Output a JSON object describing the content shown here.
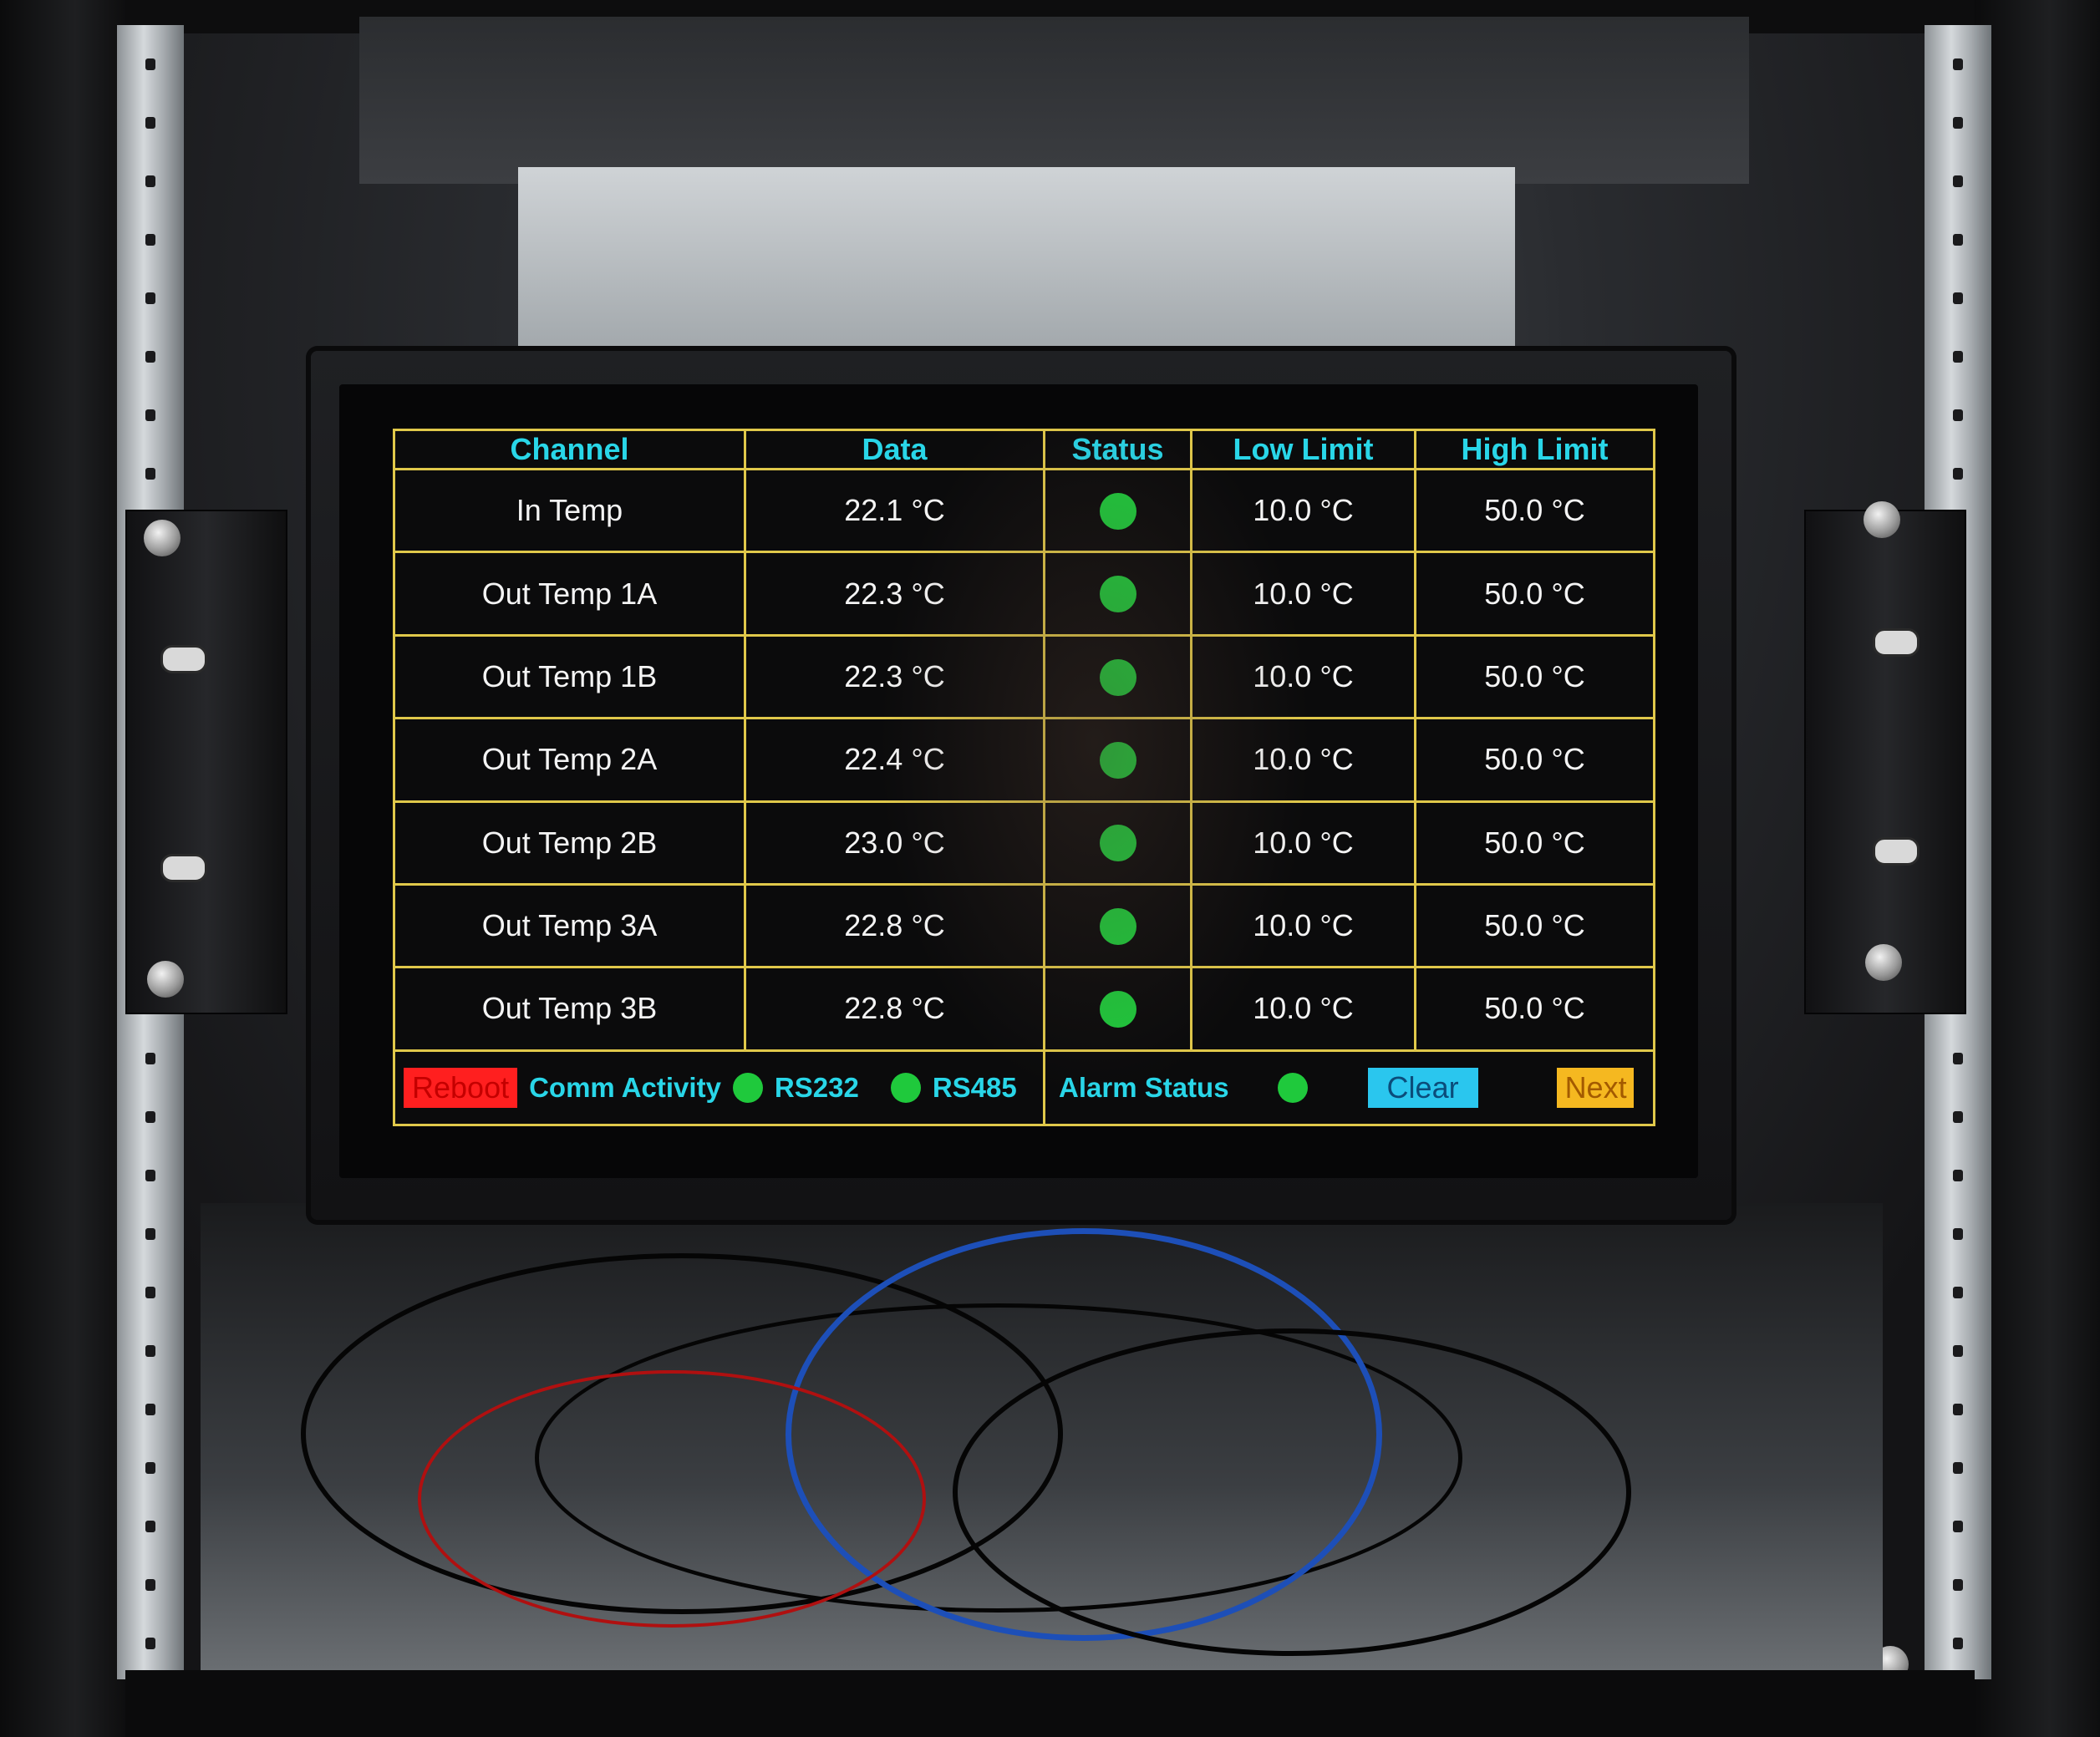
{
  "table": {
    "headers": {
      "channel": "Channel",
      "data": "Data",
      "status": "Status",
      "low_limit": "Low Limit",
      "high_limit": "High Limit"
    },
    "rows": [
      {
        "channel": "In Temp",
        "data": "22.1 °C",
        "status": "ok",
        "low": "10.0 °C",
        "high": "50.0 °C"
      },
      {
        "channel": "Out Temp 1A",
        "data": "22.3 °C",
        "status": "ok",
        "low": "10.0 °C",
        "high": "50.0 °C"
      },
      {
        "channel": "Out Temp 1B",
        "data": "22.3 °C",
        "status": "ok",
        "low": "10.0 °C",
        "high": "50.0 °C"
      },
      {
        "channel": "Out Temp 2A",
        "data": "22.4 °C",
        "status": "ok",
        "low": "10.0 °C",
        "high": "50.0 °C"
      },
      {
        "channel": "Out Temp 2B",
        "data": "23.0 °C",
        "status": "ok",
        "low": "10.0 °C",
        "high": "50.0 °C"
      },
      {
        "channel": "Out Temp 3A",
        "data": "22.8 °C",
        "status": "ok",
        "low": "10.0 °C",
        "high": "50.0 °C"
      },
      {
        "channel": "Out Temp 3B",
        "data": "22.8 °C",
        "status": "ok",
        "low": "10.0 °C",
        "high": "50.0 °C"
      }
    ]
  },
  "bottom_bar": {
    "reboot_label": "Reboot",
    "comm_activity_label": "Comm Activity",
    "rs232_label": "RS232",
    "rs485_label": "RS485",
    "alarm_status_label": "Alarm Status",
    "clear_label": "Clear",
    "next_label": "Next"
  },
  "colors": {
    "grid_line": "#e0c84a",
    "header_text": "#29d6e8",
    "status_ok": "#1fc93c",
    "reboot_button": "#ff1f1f",
    "clear_button": "#2ac6ee",
    "next_button": "#f5b820"
  },
  "icons": {
    "status_indicator": "green-dot-icon"
  }
}
